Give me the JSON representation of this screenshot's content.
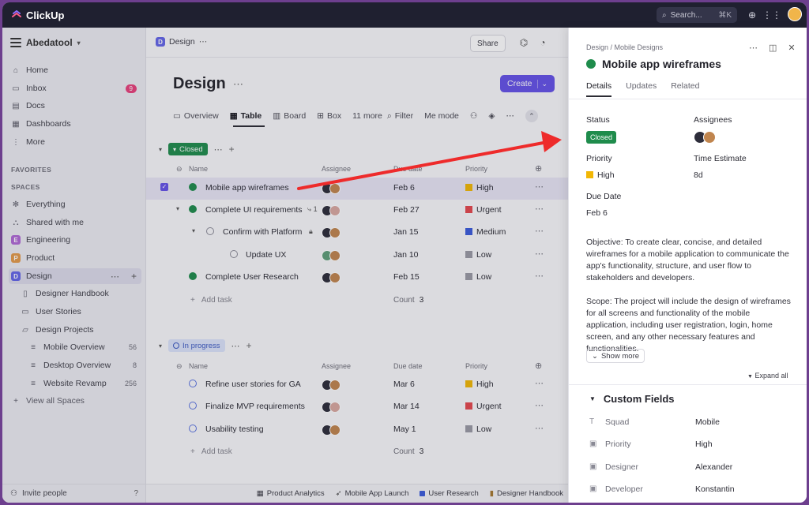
{
  "topbar": {
    "app_name": "ClickUp",
    "search_placeholder": "Search...",
    "search_shortcut": "⌘K"
  },
  "sidebar": {
    "workspace": "Abedatool",
    "nav": [
      {
        "label": "Home",
        "icon": "home-icon"
      },
      {
        "label": "Inbox",
        "icon": "inbox-icon",
        "badge": "9"
      },
      {
        "label": "Docs",
        "icon": "docs-icon"
      },
      {
        "label": "Dashboards",
        "icon": "dashboard-icon"
      },
      {
        "label": "More",
        "icon": "more-icon"
      }
    ],
    "favorites_label": "FAVORITES",
    "spaces_label": "SPACES",
    "spaces": [
      {
        "label": "Everything",
        "icon": "everything-icon"
      },
      {
        "label": "Shared with me",
        "icon": "shared-icon"
      },
      {
        "label": "Engineering",
        "letter": "E",
        "color": "#b069d6"
      },
      {
        "label": "Product",
        "letter": "P",
        "color": "#e39a4a"
      },
      {
        "label": "Design",
        "letter": "D",
        "color": "#6366e8"
      }
    ],
    "design_children": [
      {
        "label": "Designer Handbook"
      },
      {
        "label": "User Stories"
      },
      {
        "label": "Design Projects"
      }
    ],
    "project_children": [
      {
        "label": "Mobile Overview",
        "count": "56"
      },
      {
        "label": "Desktop Overview",
        "count": "8"
      },
      {
        "label": "Website Revamp",
        "count": "256"
      }
    ],
    "view_all": "View all Spaces",
    "invite": "Invite people"
  },
  "main": {
    "breadcrumb": "Design",
    "share": "Share",
    "title": "Design",
    "create": "Create",
    "views": [
      "Overview",
      "Table",
      "Board",
      "Box",
      "11 more"
    ],
    "filter": "Filter",
    "me_mode": "Me mode",
    "columns": {
      "name": "Name",
      "assignee": "Assignee",
      "due": "Due date",
      "priority": "Priority"
    },
    "group_closed": {
      "label": "Closed",
      "tasks": [
        {
          "name": "Mobile app wireframes",
          "due": "Feb 6",
          "priority": "High"
        },
        {
          "name": "Complete UI requirements",
          "due": "Feb 27",
          "priority": "Urgent",
          "subtasks": "1"
        },
        {
          "name": "Confirm with Platform",
          "due": "Jan 15",
          "priority": "Medium"
        },
        {
          "name": "Update UX",
          "due": "Jan 10",
          "priority": "Low"
        },
        {
          "name": "Complete User Research",
          "due": "Feb 15",
          "priority": "Low"
        }
      ],
      "add_task": "Add task",
      "count_label": "Count",
      "count": "3"
    },
    "group_progress": {
      "label": "In progress",
      "tasks": [
        {
          "name": "Refine user stories for GA",
          "due": "Mar 6",
          "priority": "High"
        },
        {
          "name": "Finalize MVP requirements",
          "due": "Mar 14",
          "priority": "Urgent"
        },
        {
          "name": "Usability testing",
          "due": "May 1",
          "priority": "Low"
        }
      ],
      "add_task": "Add task",
      "count_label": "Count",
      "count": "3"
    }
  },
  "bottombar": [
    "Product Analytics",
    "Mobile App Launch",
    "User Research",
    "Designer Handbook"
  ],
  "panel": {
    "breadcrumb": "Design  /  Mobile Designs",
    "title": "Mobile app wireframes",
    "tabs": [
      "Details",
      "Updates",
      "Related"
    ],
    "status_label": "Status",
    "status_value": "Closed",
    "assignees_label": "Assignees",
    "priority_label": "Priority",
    "priority_value": "High",
    "time_label": "Time Estimate",
    "time_value": "8d",
    "due_label": "Due Date",
    "due_value": "Feb 6",
    "objective": "Objective: To create clear, concise, and detailed wireframes for a mobile application to communicate the app's functionality, structure, and user flow to stakeholders and developers.",
    "scope": "Scope: The project will include the design of wireframes for all screens and functionality of the mobile application, including user registration, login, home screen, and any other necessary features and functionalities.",
    "show_more": "Show more",
    "expand_all": "Expand all",
    "custom_fields_title": "Custom Fields",
    "custom_fields": [
      {
        "name": "Squad",
        "value": "Mobile"
      },
      {
        "name": "Priority",
        "value": "High"
      },
      {
        "name": "Designer",
        "value": "Alexander"
      },
      {
        "name": "Developer",
        "value": "Konstantin"
      }
    ]
  },
  "colors": {
    "accent": "#6552e8",
    "closed": "#1f8c4c",
    "annotation_arrow": "#ee2b2b",
    "flag_high": "#f2b705",
    "flag_urgent": "#e5484d",
    "flag_medium": "#3b5bdb",
    "flag_low": "#9a9aa5"
  }
}
